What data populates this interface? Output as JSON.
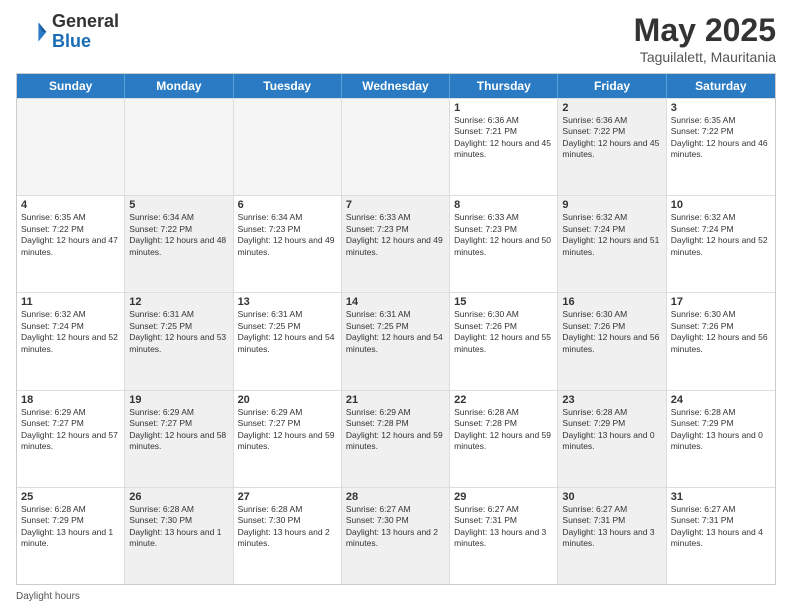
{
  "header": {
    "logo_general": "General",
    "logo_blue": "Blue",
    "title": "May 2025",
    "location": "Taguilalett, Mauritania"
  },
  "days_of_week": [
    "Sunday",
    "Monday",
    "Tuesday",
    "Wednesday",
    "Thursday",
    "Friday",
    "Saturday"
  ],
  "footer_text": "Daylight hours",
  "weeks": [
    [
      {
        "day": "",
        "sunrise": "",
        "sunset": "",
        "daylight": "",
        "shaded": true
      },
      {
        "day": "",
        "sunrise": "",
        "sunset": "",
        "daylight": "",
        "shaded": true
      },
      {
        "day": "",
        "sunrise": "",
        "sunset": "",
        "daylight": "",
        "shaded": true
      },
      {
        "day": "",
        "sunrise": "",
        "sunset": "",
        "daylight": "",
        "shaded": true
      },
      {
        "day": "1",
        "sunrise": "Sunrise: 6:36 AM",
        "sunset": "Sunset: 7:21 PM",
        "daylight": "Daylight: 12 hours and 45 minutes.",
        "shaded": false
      },
      {
        "day": "2",
        "sunrise": "Sunrise: 6:36 AM",
        "sunset": "Sunset: 7:22 PM",
        "daylight": "Daylight: 12 hours and 45 minutes.",
        "shaded": true
      },
      {
        "day": "3",
        "sunrise": "Sunrise: 6:35 AM",
        "sunset": "Sunset: 7:22 PM",
        "daylight": "Daylight: 12 hours and 46 minutes.",
        "shaded": false
      }
    ],
    [
      {
        "day": "4",
        "sunrise": "Sunrise: 6:35 AM",
        "sunset": "Sunset: 7:22 PM",
        "daylight": "Daylight: 12 hours and 47 minutes.",
        "shaded": false
      },
      {
        "day": "5",
        "sunrise": "Sunrise: 6:34 AM",
        "sunset": "Sunset: 7:22 PM",
        "daylight": "Daylight: 12 hours and 48 minutes.",
        "shaded": true
      },
      {
        "day": "6",
        "sunrise": "Sunrise: 6:34 AM",
        "sunset": "Sunset: 7:23 PM",
        "daylight": "Daylight: 12 hours and 49 minutes.",
        "shaded": false
      },
      {
        "day": "7",
        "sunrise": "Sunrise: 6:33 AM",
        "sunset": "Sunset: 7:23 PM",
        "daylight": "Daylight: 12 hours and 49 minutes.",
        "shaded": true
      },
      {
        "day": "8",
        "sunrise": "Sunrise: 6:33 AM",
        "sunset": "Sunset: 7:23 PM",
        "daylight": "Daylight: 12 hours and 50 minutes.",
        "shaded": false
      },
      {
        "day": "9",
        "sunrise": "Sunrise: 6:32 AM",
        "sunset": "Sunset: 7:24 PM",
        "daylight": "Daylight: 12 hours and 51 minutes.",
        "shaded": true
      },
      {
        "day": "10",
        "sunrise": "Sunrise: 6:32 AM",
        "sunset": "Sunset: 7:24 PM",
        "daylight": "Daylight: 12 hours and 52 minutes.",
        "shaded": false
      }
    ],
    [
      {
        "day": "11",
        "sunrise": "Sunrise: 6:32 AM",
        "sunset": "Sunset: 7:24 PM",
        "daylight": "Daylight: 12 hours and 52 minutes.",
        "shaded": false
      },
      {
        "day": "12",
        "sunrise": "Sunrise: 6:31 AM",
        "sunset": "Sunset: 7:25 PM",
        "daylight": "Daylight: 12 hours and 53 minutes.",
        "shaded": true
      },
      {
        "day": "13",
        "sunrise": "Sunrise: 6:31 AM",
        "sunset": "Sunset: 7:25 PM",
        "daylight": "Daylight: 12 hours and 54 minutes.",
        "shaded": false
      },
      {
        "day": "14",
        "sunrise": "Sunrise: 6:31 AM",
        "sunset": "Sunset: 7:25 PM",
        "daylight": "Daylight: 12 hours and 54 minutes.",
        "shaded": true
      },
      {
        "day": "15",
        "sunrise": "Sunrise: 6:30 AM",
        "sunset": "Sunset: 7:26 PM",
        "daylight": "Daylight: 12 hours and 55 minutes.",
        "shaded": false
      },
      {
        "day": "16",
        "sunrise": "Sunrise: 6:30 AM",
        "sunset": "Sunset: 7:26 PM",
        "daylight": "Daylight: 12 hours and 56 minutes.",
        "shaded": true
      },
      {
        "day": "17",
        "sunrise": "Sunrise: 6:30 AM",
        "sunset": "Sunset: 7:26 PM",
        "daylight": "Daylight: 12 hours and 56 minutes.",
        "shaded": false
      }
    ],
    [
      {
        "day": "18",
        "sunrise": "Sunrise: 6:29 AM",
        "sunset": "Sunset: 7:27 PM",
        "daylight": "Daylight: 12 hours and 57 minutes.",
        "shaded": false
      },
      {
        "day": "19",
        "sunrise": "Sunrise: 6:29 AM",
        "sunset": "Sunset: 7:27 PM",
        "daylight": "Daylight: 12 hours and 58 minutes.",
        "shaded": true
      },
      {
        "day": "20",
        "sunrise": "Sunrise: 6:29 AM",
        "sunset": "Sunset: 7:27 PM",
        "daylight": "Daylight: 12 hours and 59 minutes.",
        "shaded": false
      },
      {
        "day": "21",
        "sunrise": "Sunrise: 6:29 AM",
        "sunset": "Sunset: 7:28 PM",
        "daylight": "Daylight: 12 hours and 59 minutes.",
        "shaded": true
      },
      {
        "day": "22",
        "sunrise": "Sunrise: 6:28 AM",
        "sunset": "Sunset: 7:28 PM",
        "daylight": "Daylight: 12 hours and 59 minutes.",
        "shaded": false
      },
      {
        "day": "23",
        "sunrise": "Sunrise: 6:28 AM",
        "sunset": "Sunset: 7:29 PM",
        "daylight": "Daylight: 13 hours and 0 minutes.",
        "shaded": true
      },
      {
        "day": "24",
        "sunrise": "Sunrise: 6:28 AM",
        "sunset": "Sunset: 7:29 PM",
        "daylight": "Daylight: 13 hours and 0 minutes.",
        "shaded": false
      }
    ],
    [
      {
        "day": "25",
        "sunrise": "Sunrise: 6:28 AM",
        "sunset": "Sunset: 7:29 PM",
        "daylight": "Daylight: 13 hours and 1 minute.",
        "shaded": false
      },
      {
        "day": "26",
        "sunrise": "Sunrise: 6:28 AM",
        "sunset": "Sunset: 7:30 PM",
        "daylight": "Daylight: 13 hours and 1 minute.",
        "shaded": true
      },
      {
        "day": "27",
        "sunrise": "Sunrise: 6:28 AM",
        "sunset": "Sunset: 7:30 PM",
        "daylight": "Daylight: 13 hours and 2 minutes.",
        "shaded": false
      },
      {
        "day": "28",
        "sunrise": "Sunrise: 6:27 AM",
        "sunset": "Sunset: 7:30 PM",
        "daylight": "Daylight: 13 hours and 2 minutes.",
        "shaded": true
      },
      {
        "day": "29",
        "sunrise": "Sunrise: 6:27 AM",
        "sunset": "Sunset: 7:31 PM",
        "daylight": "Daylight: 13 hours and 3 minutes.",
        "shaded": false
      },
      {
        "day": "30",
        "sunrise": "Sunrise: 6:27 AM",
        "sunset": "Sunset: 7:31 PM",
        "daylight": "Daylight: 13 hours and 3 minutes.",
        "shaded": true
      },
      {
        "day": "31",
        "sunrise": "Sunrise: 6:27 AM",
        "sunset": "Sunset: 7:31 PM",
        "daylight": "Daylight: 13 hours and 4 minutes.",
        "shaded": false
      }
    ]
  ]
}
